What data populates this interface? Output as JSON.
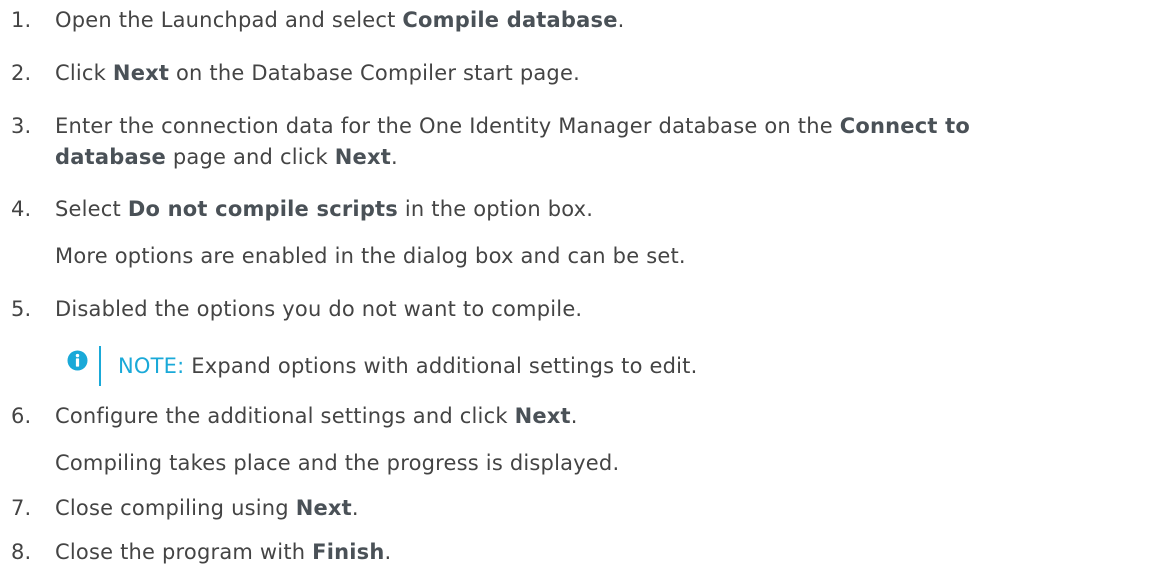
{
  "steps": [
    {
      "num": "1.",
      "pre": "Open the Launchpad and select ",
      "bold": "Compile database",
      "post": "."
    },
    {
      "num": "2.",
      "pre": "Click ",
      "bold": "Next",
      "post": " on the Database Compiler start page."
    },
    {
      "num": "3.",
      "pre": "Enter the connection data for the One Identity Manager database on the ",
      "bold": "Connect to",
      "line2_bold": "database",
      "line2_mid": " page and click ",
      "line2_bold2": "Next",
      "line2_post": "."
    },
    {
      "num": "4.",
      "pre": "Select ",
      "bold": "Do not compile scripts",
      "post": " in the option box.",
      "sub": "More options are enabled in the dialog box and can be set."
    },
    {
      "num": "5.",
      "pre": "Disabled the options you do not want to compile."
    },
    {
      "num": "6.",
      "pre": "Configure the additional settings and click ",
      "bold": "Next",
      "post": ".",
      "sub": "Compiling takes place and the progress is displayed."
    },
    {
      "num": "7.",
      "pre": "Close compiling using ",
      "bold": "Next",
      "post": "."
    },
    {
      "num": "8.",
      "pre": "Close the program with ",
      "bold": "Finish",
      "post": "."
    }
  ],
  "note": {
    "label": "NOTE:",
    "text": " Expand options with additional settings to edit.",
    "icon": "info-icon",
    "color": "#1aa9d8"
  }
}
